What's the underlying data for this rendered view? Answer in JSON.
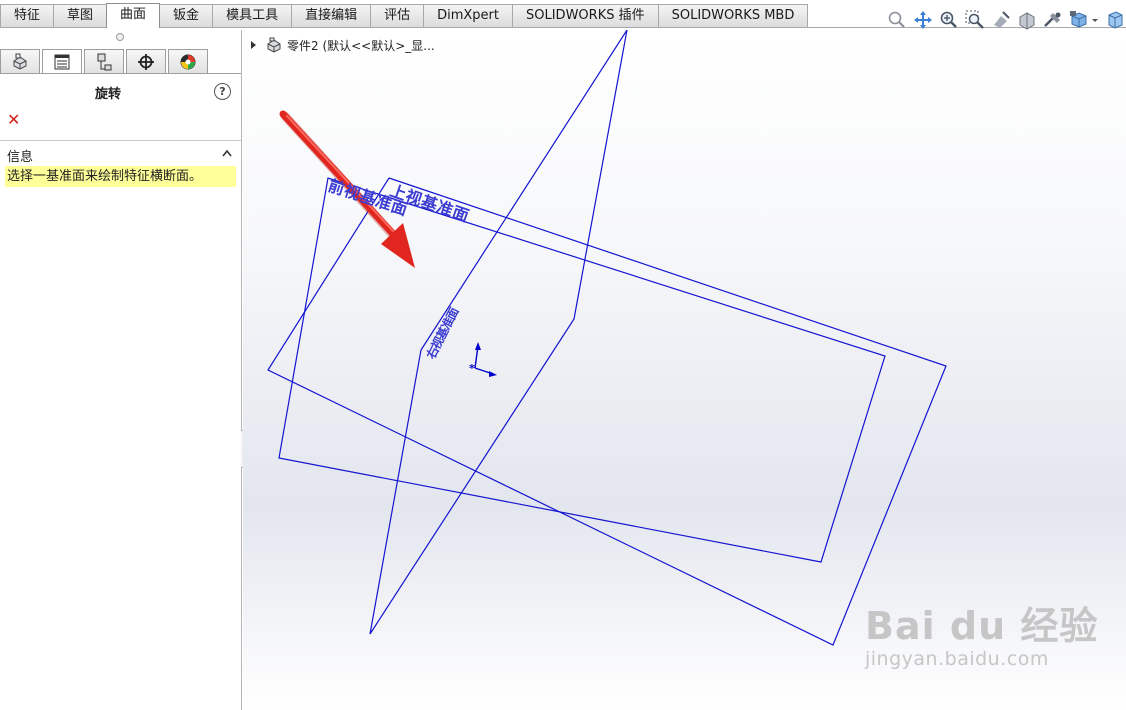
{
  "command_tabs": [
    {
      "label": "特征",
      "active": false
    },
    {
      "label": "草图",
      "active": false
    },
    {
      "label": "曲面",
      "active": true
    },
    {
      "label": "钣金",
      "active": false
    },
    {
      "label": "模具工具",
      "active": false
    },
    {
      "label": "直接编辑",
      "active": false
    },
    {
      "label": "评估",
      "active": false
    },
    {
      "label": "DimXpert",
      "active": false
    },
    {
      "label": "SOLIDWORKS 插件",
      "active": false
    },
    {
      "label": "SOLIDWORKS MBD",
      "active": false
    }
  ],
  "heads_up_toolbar": {
    "icons": [
      "zoom-to-fit-icon",
      "pan-icon",
      "zoom-in-icon",
      "zoom-to-area-icon",
      "section-view-icon",
      "previous-view-icon",
      "display-style-icon",
      "view-orientation-icon",
      "dropdown-icon",
      "hide-show-items-icon"
    ]
  },
  "manager_tabs": {
    "icons": [
      "feature-manager-icon",
      "property-manager-icon",
      "configuration-manager-icon",
      "dimxpert-manager-icon",
      "display-manager-icon"
    ],
    "active_index": 1
  },
  "property_manager": {
    "title": "旋转",
    "help": "?",
    "cancel": "✕",
    "group_title": "信息",
    "message": "选择一基准面来绘制特征横断面。"
  },
  "tree": {
    "part_label": "零件2  (默认<<默认>_显..."
  },
  "planes": {
    "front_label": "前视基准面",
    "top_label": "上视基准面",
    "right_label": "右视基准面"
  },
  "colors": {
    "plane_outline": "#1414d2",
    "plane_label": "#3c3cd2",
    "arrow_red": "#e0261e",
    "info_highlight": "#ffff99",
    "cancel_red": "#d2231e"
  },
  "watermark": {
    "main": "Bai du 经验",
    "sub": "jingyan.baidu.com"
  }
}
